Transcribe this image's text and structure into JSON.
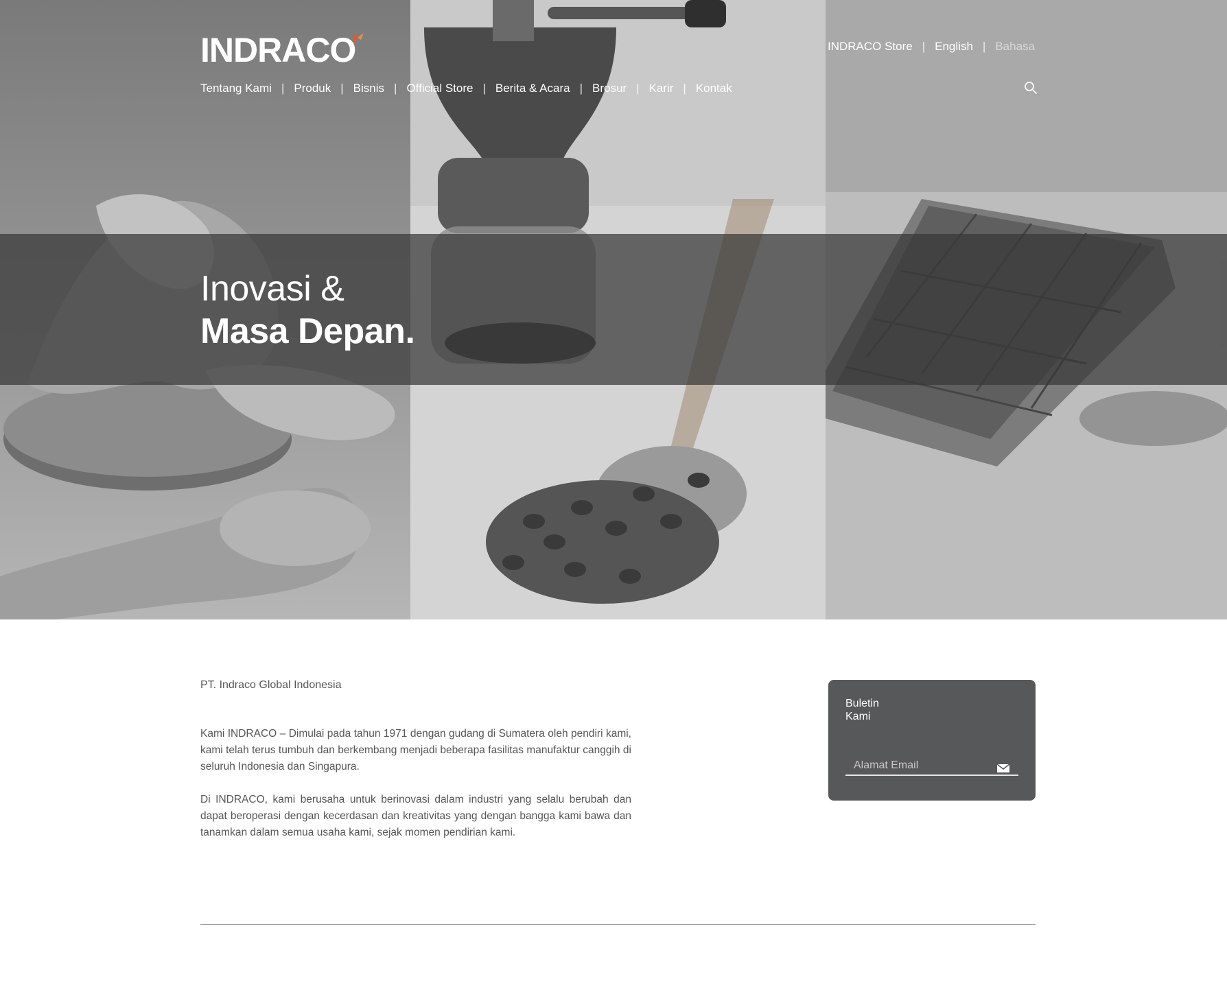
{
  "header": {
    "logo_text": "INDRACO",
    "top_links": [
      "INDRACO Store",
      "English",
      "Bahasa"
    ],
    "nav": [
      "Tentang Kami",
      "Produk",
      "Bisnis",
      "Official Store",
      "Berita & Acara",
      "Brosur",
      "Karir",
      "Kontak"
    ],
    "search_icon": "search-icon"
  },
  "hero": {
    "line1": "Inovasi &",
    "line2": "Masa Depan.",
    "images": [
      "ginger-and-wooden-spoon",
      "coffee-grinder-and-beans",
      "chocolate-bar"
    ]
  },
  "content": {
    "company": "PT. Indraco Global Indonesia",
    "paragraph1": "Kami INDRACO – Dimulai pada tahun 1971 dengan gudang di Sumatera oleh pendiri kami, kami telah terus tumbuh dan berkembang menjadi beberapa fasilitas manufaktur canggih di seluruh Indonesia dan Singapura.",
    "paragraph2": "Di INDRACO, kami berusaha untuk berinovasi dalam industri yang selalu berubah dan dapat beroperasi dengan kecerdasan dan kreativitas yang dengan bangga kami bawa dan tanamkan dalam semua usaha kami, sejak momen pendirian kami."
  },
  "newsletter": {
    "title": "Buletin Kami",
    "email_placeholder": "Alamat Email",
    "submit_icon": "envelope-icon"
  },
  "colors": {
    "accent": "#e05a2b",
    "newsletter_bg": "#57585a",
    "text": "#555555"
  }
}
